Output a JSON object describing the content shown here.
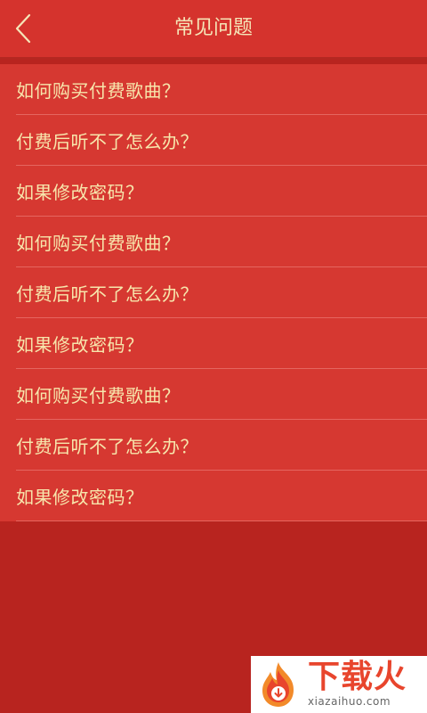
{
  "header": {
    "title": "常见问题",
    "back_icon": "chevron-left-icon"
  },
  "faq": {
    "items": [
      {
        "question": "如何购买付费歌曲？"
      },
      {
        "question": "付费后听不了怎么办？"
      },
      {
        "question": "如果修改密码？"
      },
      {
        "question": "如何购买付费歌曲？"
      },
      {
        "question": "付费后听不了怎么办？"
      },
      {
        "question": "如果修改密码？"
      },
      {
        "question": "如何购买付费歌曲？"
      },
      {
        "question": "付费后听不了怎么办？"
      },
      {
        "question": "如果修改密码？"
      }
    ]
  },
  "watermark": {
    "brand": "下载火",
    "domain": "xiazaihuo.com"
  },
  "colors": {
    "header_bg": "#d5332d",
    "list_bg": "#d63831",
    "page_bg": "#b8241f",
    "text": "#f7e6ac"
  }
}
